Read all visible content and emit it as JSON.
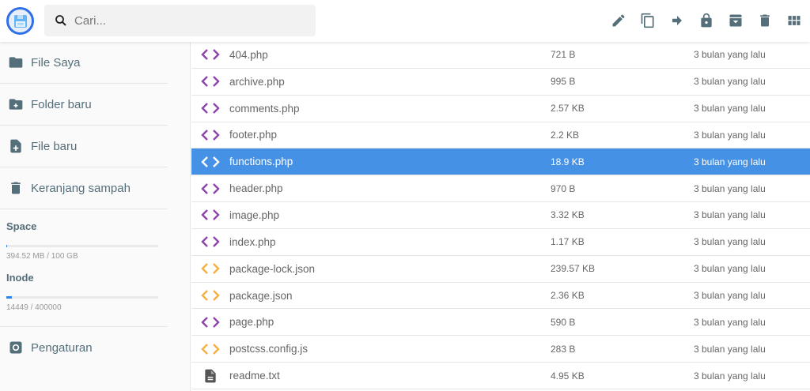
{
  "header": {
    "search_placeholder": "Cari..."
  },
  "toolbar": [
    "pencil-icon",
    "copy-icon",
    "move-icon",
    "lock-icon",
    "archive-icon",
    "trash-icon",
    "grid-icon"
  ],
  "sidebar": {
    "items": [
      {
        "label": "File Saya"
      },
      {
        "label": "Folder baru"
      },
      {
        "label": "File baru"
      },
      {
        "label": "Keranjang sampah"
      }
    ],
    "space": {
      "title": "Space",
      "text": "394.52 MB / 100 GB",
      "percent": 0.39
    },
    "inode": {
      "title": "Inode",
      "text": "14449 / 400000",
      "percent": 3.6
    },
    "settings": "Pengaturan"
  },
  "colors": {
    "accent": "#4591e6",
    "php": "#8e44ad",
    "json": "#f5b041",
    "txt": "#555555"
  },
  "files": [
    {
      "name": "404.php",
      "size": "721 B",
      "date": "3 bulan yang lalu",
      "type": "code",
      "color": "#8e44ad"
    },
    {
      "name": "archive.php",
      "size": "995 B",
      "date": "3 bulan yang lalu",
      "type": "code",
      "color": "#8e44ad"
    },
    {
      "name": "comments.php",
      "size": "2.57 KB",
      "date": "3 bulan yang lalu",
      "type": "code",
      "color": "#8e44ad"
    },
    {
      "name": "footer.php",
      "size": "2.2 KB",
      "date": "3 bulan yang lalu",
      "type": "code",
      "color": "#8e44ad"
    },
    {
      "name": "functions.php",
      "size": "18.9 KB",
      "date": "3 bulan yang lalu",
      "type": "code",
      "color": "#ffffff",
      "selected": true
    },
    {
      "name": "header.php",
      "size": "970 B",
      "date": "3 bulan yang lalu",
      "type": "code",
      "color": "#8e44ad"
    },
    {
      "name": "image.php",
      "size": "3.32 KB",
      "date": "3 bulan yang lalu",
      "type": "code",
      "color": "#8e44ad"
    },
    {
      "name": "index.php",
      "size": "1.17 KB",
      "date": "3 bulan yang lalu",
      "type": "code",
      "color": "#8e44ad"
    },
    {
      "name": "package-lock.json",
      "size": "239.57 KB",
      "date": "3 bulan yang lalu",
      "type": "code",
      "color": "#f5b041"
    },
    {
      "name": "package.json",
      "size": "2.36 KB",
      "date": "3 bulan yang lalu",
      "type": "code",
      "color": "#f5b041"
    },
    {
      "name": "page.php",
      "size": "590 B",
      "date": "3 bulan yang lalu",
      "type": "code",
      "color": "#8e44ad"
    },
    {
      "name": "postcss.config.js",
      "size": "283 B",
      "date": "3 bulan yang lalu",
      "type": "code",
      "color": "#f5b041"
    },
    {
      "name": "readme.txt",
      "size": "4.95 KB",
      "date": "3 bulan yang lalu",
      "type": "doc",
      "color": "#555555"
    }
  ]
}
